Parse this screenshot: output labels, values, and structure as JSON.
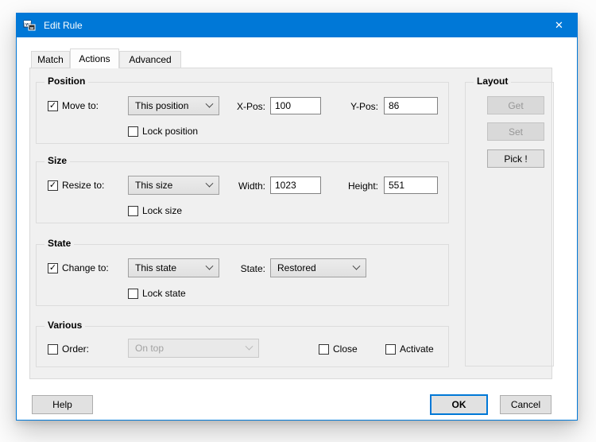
{
  "window": {
    "title": "Edit Rule"
  },
  "icons": {
    "close": "✕",
    "check": "✓"
  },
  "tabs": [
    {
      "label": "Match"
    },
    {
      "label": "Actions"
    },
    {
      "label": "Advanced"
    }
  ],
  "position": {
    "title": "Position",
    "move_label": "Move to:",
    "dropdown": "This position",
    "x_label": "X-Pos:",
    "x_value": "100",
    "y_label": "Y-Pos:",
    "y_value": "86",
    "lock_label": "Lock position"
  },
  "size": {
    "title": "Size",
    "resize_label": "Resize to:",
    "dropdown": "This size",
    "width_label": "Width:",
    "width_value": "1023",
    "height_label": "Height:",
    "height_value": "551",
    "lock_label": "Lock size"
  },
  "state": {
    "title": "State",
    "change_label": "Change to:",
    "dropdown": "This state",
    "state_label": "State:",
    "state_value": "Restored",
    "lock_label": "Lock state"
  },
  "various": {
    "title": "Various",
    "order_label": "Order:",
    "order_value": "On top",
    "close_label": "Close",
    "activate_label": "Activate"
  },
  "layout": {
    "title": "Layout",
    "get_label": "Get",
    "set_label": "Set",
    "pick_label": "Pick !"
  },
  "footer": {
    "help": "Help",
    "ok": "OK",
    "cancel": "Cancel"
  },
  "colors": {
    "titlebar": "#0078d7",
    "accent": "#0078d7",
    "page": "#f0f0f0"
  }
}
